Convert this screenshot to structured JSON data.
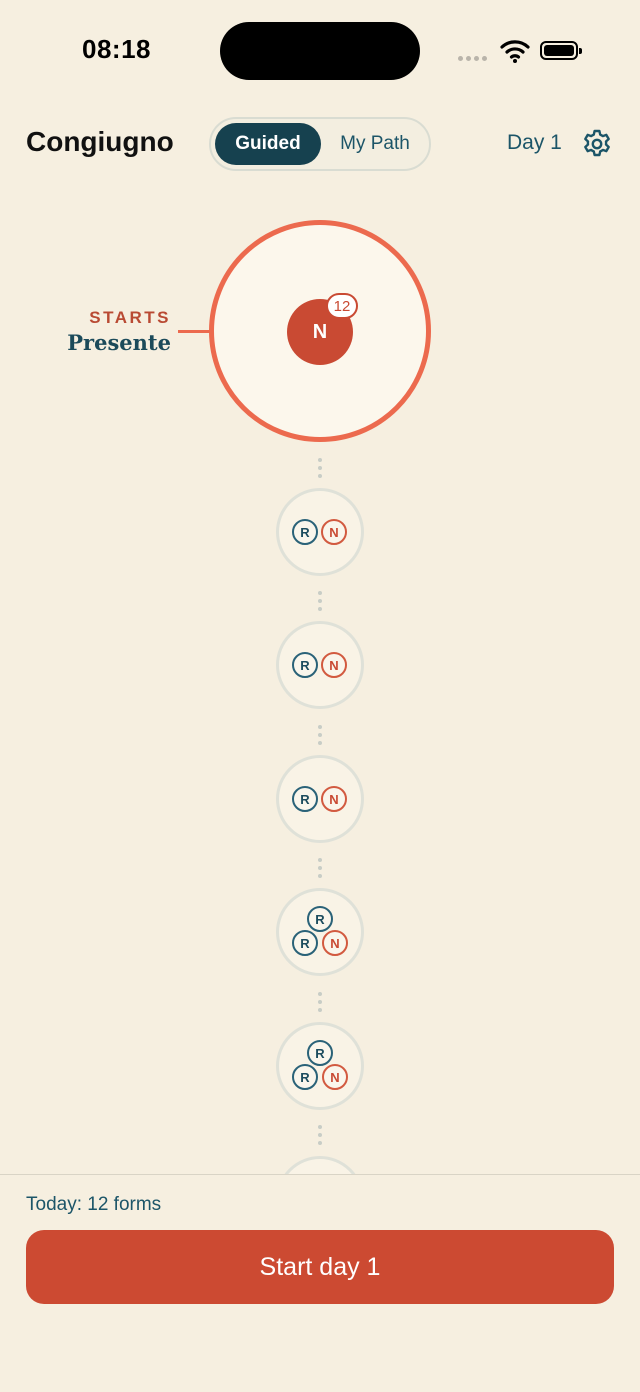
{
  "status_bar": {
    "time": "08:18"
  },
  "header": {
    "title": "Congiugno",
    "segments": {
      "active": "Guided",
      "inactive": "My Path"
    },
    "day": "Day 1"
  },
  "path": {
    "start_node": {
      "starts_label": "STARTS",
      "tense": "Presente",
      "letter": "N",
      "count": "12"
    },
    "nodes": [
      {
        "chips": [
          "R",
          "N"
        ]
      },
      {
        "chips": [
          "R",
          "N"
        ]
      },
      {
        "chips": [
          "R",
          "N"
        ]
      },
      {
        "chips": [
          "R",
          "R",
          "N"
        ]
      },
      {
        "chips": [
          "R",
          "R",
          "N"
        ]
      }
    ]
  },
  "footer": {
    "today": "Today: 12 forms",
    "cta": "Start day 1"
  },
  "colors": {
    "accent": "#cc4a32",
    "primary": "#16414f",
    "background": "#f6efe0"
  }
}
